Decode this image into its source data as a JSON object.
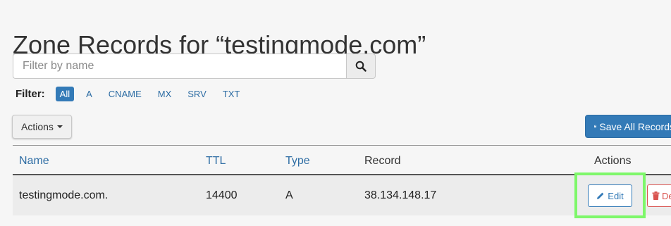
{
  "page": {
    "title": "Zone Records for “testingmode.com”"
  },
  "search": {
    "placeholder": "Filter by name",
    "value": "",
    "button_icon": "search-icon"
  },
  "filter": {
    "label": "Filter:",
    "options": [
      "All",
      "A",
      "CNAME",
      "MX",
      "SRV",
      "TXT"
    ],
    "active": "All"
  },
  "toolbar": {
    "actions_label": "Actions",
    "save_all_label": "Save All Records",
    "save_icon": "floppy-disk-icon"
  },
  "table": {
    "columns": {
      "name": "Name",
      "ttl": "TTL",
      "type": "Type",
      "record": "Record",
      "actions": "Actions"
    },
    "rows": [
      {
        "name": "testingmode.com.",
        "ttl": "14400",
        "type": "A",
        "record": "38.134.148.17",
        "edit_label": "Edit",
        "delete_label": "Delete"
      }
    ]
  },
  "colors": {
    "accent": "#337ab7",
    "danger": "#d9534f",
    "highlight": "#7ef76a",
    "background": "#f6f6f6"
  }
}
